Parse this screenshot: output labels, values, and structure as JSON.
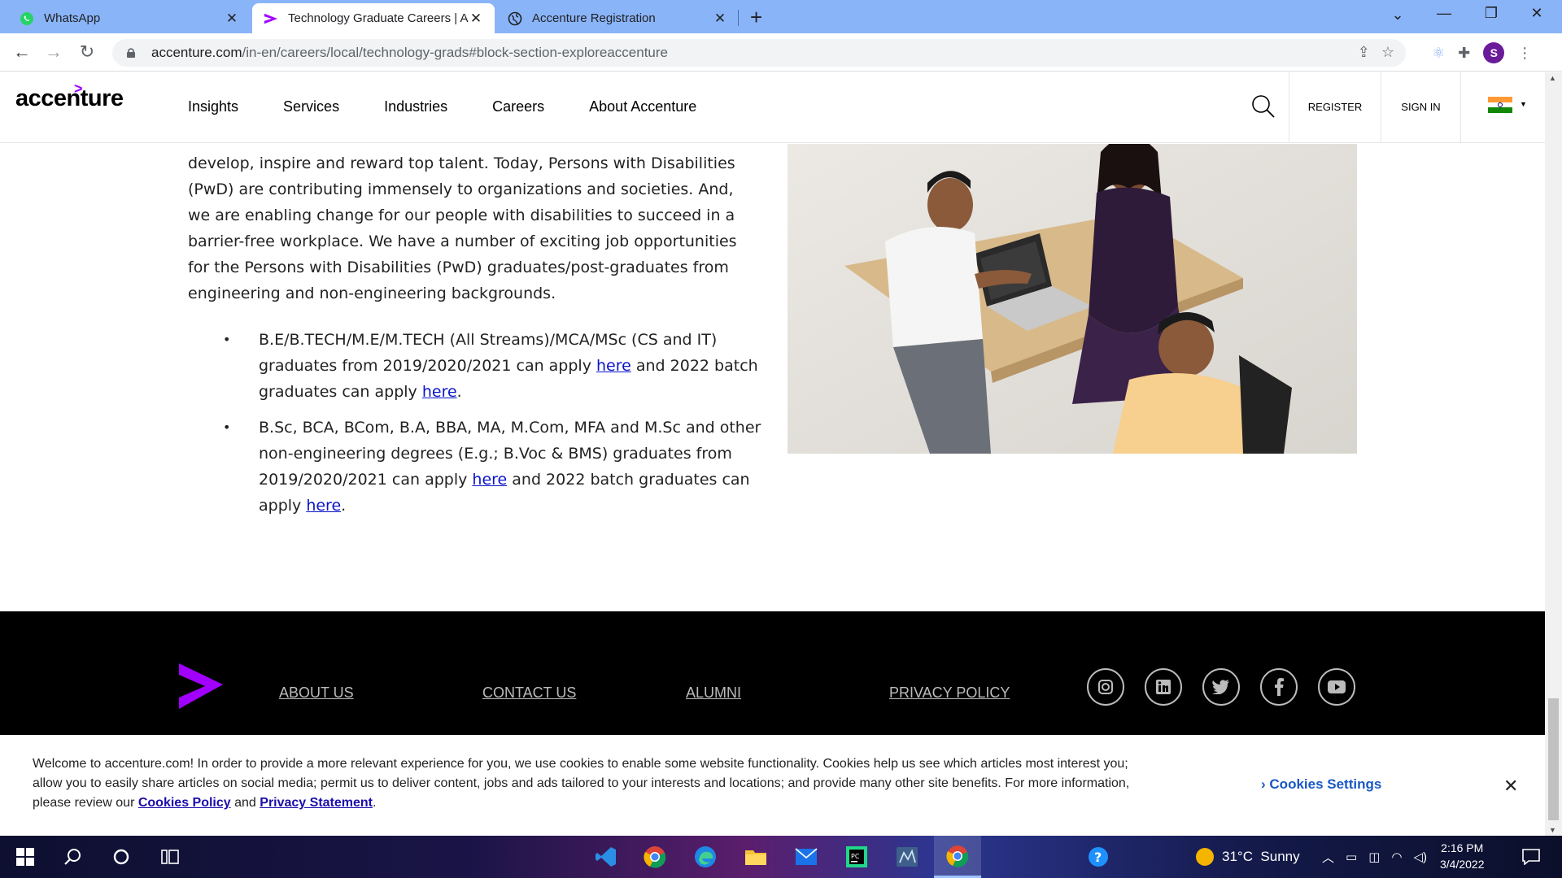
{
  "browser": {
    "tabs": [
      {
        "title": "WhatsApp",
        "icon": "whatsapp-icon"
      },
      {
        "title": "Technology Graduate Careers | Ac",
        "icon": "accenture-icon"
      },
      {
        "title": "Accenture Registration",
        "icon": "globe-icon"
      }
    ],
    "url_host": "accenture.com",
    "url_path": "/in-en/careers/local/technology-grads#block-section-exploreaccenture",
    "profile_initial": "S"
  },
  "header": {
    "logo_text": "accenture",
    "nav": [
      "Insights",
      "Services",
      "Industries",
      "Careers",
      "About Accenture"
    ],
    "register": "REGISTER",
    "sign_in": "SIGN IN"
  },
  "content": {
    "intro": "develop, inspire and reward top talent. Today, Persons with Disabilities (PwD) are contributing immensely to organizations and societies. And, we are enabling change for our people with disabilities to succeed in a barrier-free workplace. We have a number of exciting job opportunities for the Persons with Disabilities (PwD) graduates/post-graduates from engineering and non-engineering backgrounds.",
    "bullet1": {
      "a": "B.E/B.TECH/M.E/M.TECH (All Streams)/MCA/MSc (CS and IT) graduates from 2019/2020/2021 can apply ",
      "link1": "here",
      "b": " and 2022 batch graduates can apply ",
      "link2": "here",
      "c": "."
    },
    "bullet2": {
      "a": "B.Sc, BCA, BCom, B.A, BBA, MA, M.Com, MFA and M.Sc and other non-engineering degrees (E.g.; B.Voc & BMS) graduates from 2019/2020/2021 can apply ",
      "link1": "here",
      "b": " and 2022 batch graduates can apply ",
      "link2": "here",
      "c": "."
    }
  },
  "footer": {
    "links": [
      "ABOUT US",
      "CONTACT US",
      "ALUMNI",
      "PRIVACY POLICY"
    ],
    "social": [
      "instagram-icon",
      "linkedin-icon",
      "twitter-icon",
      "facebook-icon",
      "youtube-icon"
    ]
  },
  "cookie": {
    "text": "Welcome to accenture.com! In order to provide a more relevant experience for you, we use cookies to enable some website functionality. Cookies help us see which articles most interest you; allow you to easily share articles on social media; permit us to deliver content, jobs and ads tailored to your interests and locations; and provide many other site benefits. For more information, please review our ",
    "policy_link": "Cookies Policy",
    "and": " and ",
    "privacy_link": "Privacy Statement",
    "end": ".",
    "settings": "Cookies Settings"
  },
  "taskbar": {
    "weather": "31°C  Sunny",
    "time": "2:16 PM",
    "date": "3/4/2022"
  },
  "colors": {
    "accent": "#a100ff",
    "tabbar": "#8ab4f8",
    "link": "#0a14c8"
  }
}
